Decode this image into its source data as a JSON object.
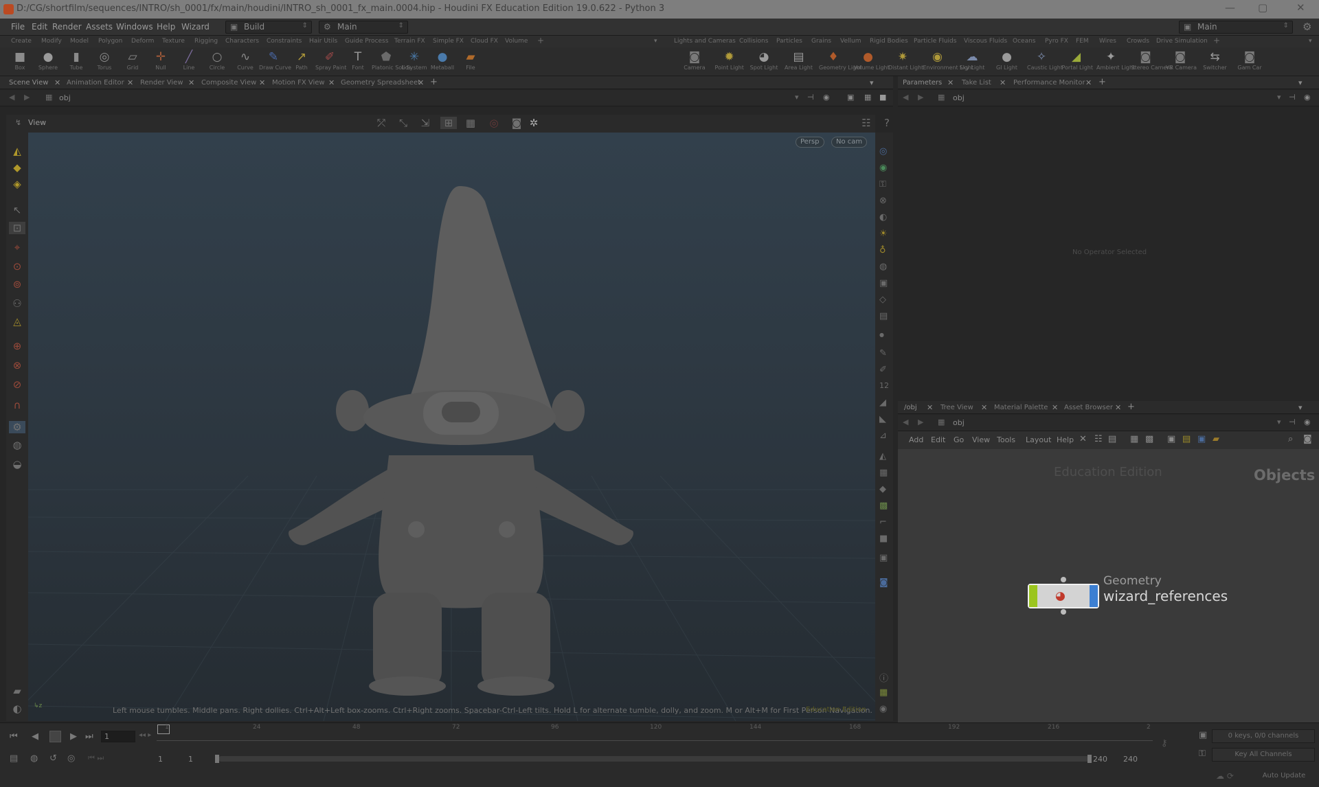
{
  "window": {
    "title": "D:/CG/shortfilm/sequences/INTRO/sh_0001/fx/main/houdini/INTRO_sh_0001_fx_main.0004.hip - Houdini FX Education Edition 19.0.622 - Python 3"
  },
  "menubar": {
    "items": [
      "File",
      "Edit",
      "Render",
      "Assets",
      "Windows",
      "Help",
      "Wizard"
    ],
    "desktop": "Build",
    "context": "Main",
    "right_desktop": "Main"
  },
  "shelf_tabs_left": [
    "Create",
    "Modify",
    "Model",
    "Polygon",
    "Deform",
    "Texture",
    "Rigging",
    "Characters",
    "Constraints",
    "Hair Utils",
    "Guide Process",
    "Terrain FX",
    "Simple FX",
    "Cloud FX",
    "Volume"
  ],
  "shelf_tabs_right": [
    "Lights and Cameras",
    "Collisions",
    "Particles",
    "Grains",
    "Vellum",
    "Rigid Bodies",
    "Particle Fluids",
    "Viscous Fluids",
    "Oceans",
    "Pyro FX",
    "FEM",
    "Wires",
    "Crowds",
    "Drive Simulation"
  ],
  "tools_left": [
    {
      "label": "Box",
      "icon": "■",
      "color": "#8c8c8c"
    },
    {
      "label": "Sphere",
      "icon": "●",
      "color": "#9a9a9a"
    },
    {
      "label": "Tube",
      "icon": "▮",
      "color": "#8a8a8a"
    },
    {
      "label": "Torus",
      "icon": "◎",
      "color": "#8a8a8a"
    },
    {
      "label": "Grid",
      "icon": "▱",
      "color": "#8a8a8a"
    },
    {
      "label": "Null",
      "icon": "✛",
      "color": "#a05a3a"
    },
    {
      "label": "Line",
      "icon": "╱",
      "color": "#7a6a9a"
    },
    {
      "label": "Circle",
      "icon": "○",
      "color": "#8a8a8a"
    },
    {
      "label": "Curve",
      "icon": "∿",
      "color": "#8a8a8a"
    },
    {
      "label": "Draw Curve",
      "icon": "✎",
      "color": "#4a6aaa"
    },
    {
      "label": "Path",
      "icon": "↗",
      "color": "#b09a3a"
    },
    {
      "label": "Spray Paint",
      "icon": "✐",
      "color": "#a04a4a"
    },
    {
      "label": "Font",
      "icon": "T",
      "color": "#9a9a9a"
    },
    {
      "label": "Platonic Solids",
      "icon": "⬟",
      "color": "#6a6a6a"
    },
    {
      "label": "L-System",
      "icon": "✳",
      "color": "#4a7aaa"
    },
    {
      "label": "Metaball",
      "icon": "●",
      "color": "#4a7aaa"
    },
    {
      "label": "File",
      "icon": "▰",
      "color": "#b06a2a"
    }
  ],
  "tools_right": [
    {
      "label": "Camera",
      "icon": "◙",
      "color": "#7a7a7a"
    },
    {
      "label": "Point Light",
      "icon": "✹",
      "color": "#b09a3a"
    },
    {
      "label": "Spot Light",
      "icon": "◕",
      "color": "#9a9a9a"
    },
    {
      "label": "Area Light",
      "icon": "▤",
      "color": "#9a9a9a"
    },
    {
      "label": "Geometry Light",
      "icon": "♦",
      "color": "#b05a2a"
    },
    {
      "label": "Volume Light",
      "icon": "●",
      "color": "#b05a2a"
    },
    {
      "label": "Distant Light",
      "icon": "✷",
      "color": "#b09a3a"
    },
    {
      "label": "Environment Light",
      "icon": "◉",
      "color": "#b09a3a"
    },
    {
      "label": "Sky Light",
      "icon": "☁",
      "color": "#7a8aaa"
    },
    {
      "label": "GI Light",
      "icon": "●",
      "color": "#9a9a9a"
    },
    {
      "label": "Caustic Light",
      "icon": "✧",
      "color": "#7a8aaa"
    },
    {
      "label": "Portal Light",
      "icon": "◢",
      "color": "#9aaa3a"
    },
    {
      "label": "Ambient Light",
      "icon": "✦",
      "color": "#9a9a9a"
    },
    {
      "label": "Stereo Camera",
      "icon": "◙",
      "color": "#7a7a7a"
    },
    {
      "label": "VR Camera",
      "icon": "◙",
      "color": "#7a7a7a"
    },
    {
      "label": "Switcher",
      "icon": "⇆",
      "color": "#9a9a9a"
    },
    {
      "label": "Gam Car",
      "icon": "◙",
      "color": "#7a7a7a"
    }
  ],
  "left_tabs": [
    "Scene View",
    "Animation Editor",
    "Render View",
    "Composite View",
    "Motion FX View",
    "Geometry Spreadsheet"
  ],
  "left_path": "obj",
  "view": {
    "label": "View",
    "persp": "Persp",
    "cam": "No cam",
    "hint": "Left mouse tumbles. Middle pans. Right dollies. Ctrl+Alt+Left box-zooms. Ctrl+Right zooms. Spacebar-Ctrl-Left tilts. Hold L for alternate tumble, dolly, and zoom.    M or Alt+M for First Person Navigation.",
    "edu_label": "Education Edition"
  },
  "params_tabs": [
    "Parameters",
    "Take List",
    "Performance Monitor"
  ],
  "params_path": "obj",
  "params_empty": "No Operator Selected",
  "net_tabs": [
    "/obj",
    "Tree View",
    "Material Palette",
    "Asset Browser"
  ],
  "net_path": "obj",
  "net_menu": [
    "Add",
    "Edit",
    "Go",
    "View",
    "Tools",
    "Layout",
    "Help"
  ],
  "net_edu": "Education Edition",
  "net_context": "Objects",
  "node": {
    "type": "Geometry",
    "name": "wizard_references"
  },
  "timeline": {
    "frame_current": "1",
    "ticks": [
      "1",
      "24",
      "48",
      "72",
      "96",
      "120",
      "144",
      "168",
      "192",
      "216",
      "2"
    ],
    "start": "1",
    "start2": "1",
    "end": "240",
    "end2": "240",
    "keys": "0 keys, 0/0 channels",
    "key_all": "Key All Channels",
    "auto_update": "Auto Update"
  }
}
